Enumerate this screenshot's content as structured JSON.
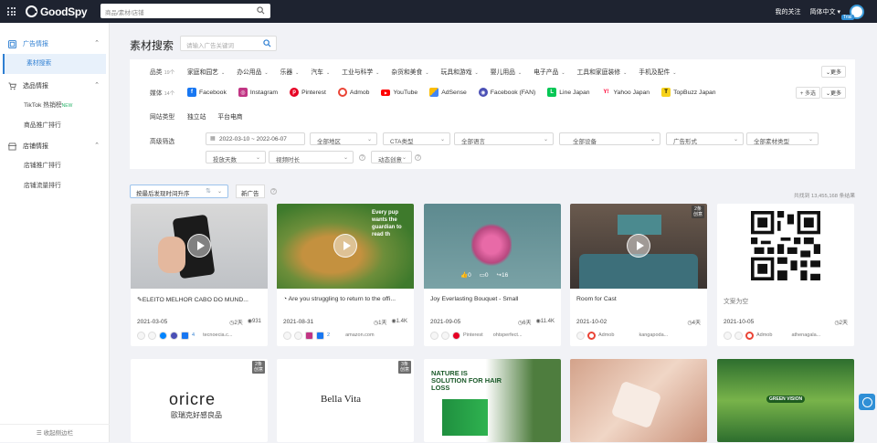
{
  "topbar": {
    "logo": "GoodSpy",
    "search_placeholder": "商品/素材/店铺",
    "my_follow": "我的关注",
    "language": "简体中文",
    "trial": "Trial"
  },
  "sidebar": {
    "sections": [
      {
        "label": "广告情报",
        "items": [
          {
            "label": "素材搜索"
          }
        ]
      },
      {
        "label": "选品情报",
        "items": [
          {
            "label": "TikTok 热销榜",
            "badge": "NEW"
          },
          {
            "label": "商品推广排行"
          }
        ]
      },
      {
        "label": "店铺情报",
        "items": [
          {
            "label": "店铺推广排行"
          },
          {
            "label": "店铺流量排行"
          }
        ]
      }
    ],
    "collapse": "收起侧边栏"
  },
  "main": {
    "title": "素材搜索",
    "keyword_placeholder": "请输入广告关键词"
  },
  "filters": {
    "category": {
      "label": "品类",
      "count": "19个",
      "items": [
        "家庭和园艺",
        "办公用品",
        "乐器",
        "汽车",
        "工业与科学",
        "杂货和美食",
        "玩具和游戏",
        "婴儿用品",
        "电子产品",
        "工具和家庭装修",
        "手机及配件"
      ],
      "more": "更多"
    },
    "media": {
      "label": "媒体",
      "count": "14个",
      "items": [
        "Facebook",
        "Instagram",
        "Pinterest",
        "Admob",
        "YouTube",
        "AdSense",
        "Facebook (FAN)",
        "Line Japan",
        "Yahoo Japan",
        "TopBuzz Japan"
      ],
      "multi": "+ 多选",
      "more": "更多"
    },
    "site_type": {
      "label": "网站类型",
      "items": [
        "独立站",
        "平台电商"
      ]
    },
    "advanced": {
      "label": "高级筛选",
      "date_range": "2022-03-10 ~ 2022-06-07",
      "region": "全部地区",
      "cta": "CTA类型",
      "language": "全部语言",
      "device": "全部设备",
      "ad_format": "广告形式",
      "material_type": "全部素材类型",
      "days": "投放天数",
      "video_length": "视频时长",
      "dynamic": "动态创意"
    }
  },
  "sort": {
    "selected": "按最后发现时间升序",
    "new_ads": "新广告",
    "total": "共找到 13,455,168 条结果"
  },
  "cards": [
    {
      "title": "ELEITO MELHOR CABO DO MUND...",
      "date": "2021-03-05",
      "days": "2天",
      "views": "931",
      "more": "4",
      "domain": "tecnoecia.c..."
    },
    {
      "title": "Are you struggling to return to the offi...",
      "date": "2021-08-31",
      "days": "1天",
      "views": "1.4K",
      "more": "2",
      "domain": "amazon.com",
      "overlay": "Every pup wants the guardian to read th"
    },
    {
      "title": "Joy Everlasting Bouquet - Small",
      "date": "2021-09-05",
      "days": "6天",
      "views": "11.4K",
      "platform": "Pinterest",
      "domain": "ohtsperfect...",
      "likes": "0",
      "comments": "0",
      "shares": "16"
    },
    {
      "title": "Room for Cast",
      "date": "2021-10-02",
      "days": "4天",
      "platform": "Admob",
      "domain": "kangapoda...",
      "badge": "2条 创意"
    },
    {
      "title": "文案为空",
      "date": "2021-10-05",
      "days": "2天",
      "platform": "Admob",
      "domain": "athenagala..."
    }
  ],
  "cards_row2": [
    {
      "brand": "ORICRE",
      "brand_sub": "歐瑞克好感良品",
      "badge": "2条 创意"
    },
    {
      "brand": "Bella Vita",
      "badge": "3条 创意"
    },
    {
      "brand": "NATURE IS SOLUTION FOR HAIR LOSS"
    },
    {
      "brand": ""
    },
    {
      "brand": "GREEN VISION"
    }
  ]
}
